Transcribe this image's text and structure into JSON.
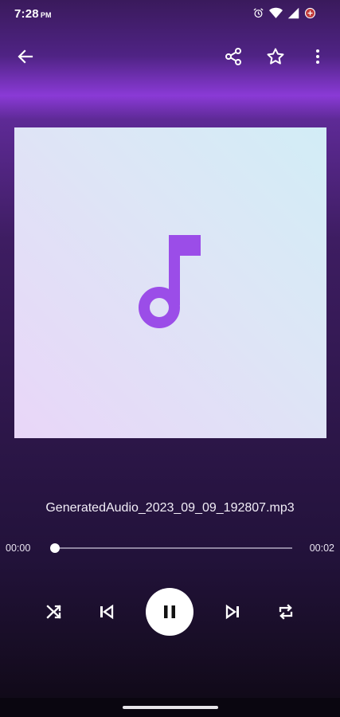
{
  "status_bar": {
    "time": "7:28",
    "ampm": "PM",
    "icons": [
      "alarm-icon",
      "wifi-icon",
      "cell-signal-icon",
      "battery-saver-icon"
    ]
  },
  "toolbar": {
    "back_icon": "arrow-left-icon",
    "share_icon": "share-icon",
    "favorite_icon": "star-outline-icon",
    "more_icon": "more-vert-icon"
  },
  "album_art": {
    "icon": "music-note-icon",
    "accent_color": "#9b4de8"
  },
  "track": {
    "filename": "GeneratedAudio_2023_09_09_192807.mp3"
  },
  "playback": {
    "elapsed": "00:00",
    "total": "00:02",
    "progress_fraction": 0.0,
    "is_playing": true
  },
  "controls": {
    "shuffle_icon": "shuffle-icon",
    "previous_icon": "skip-previous-icon",
    "pause_icon": "pause-icon",
    "next_icon": "skip-next-icon",
    "repeat_icon": "repeat-icon"
  },
  "colors": {
    "header_glow": "#8a3ad6",
    "background_dark": "#140d1c",
    "note_purple": "#9b4de8"
  }
}
